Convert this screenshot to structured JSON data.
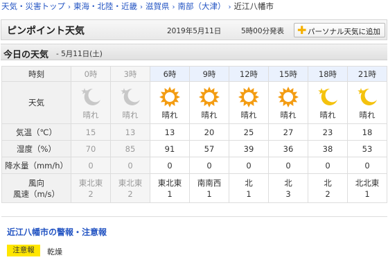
{
  "breadcrumb": [
    {
      "label": "天気・災害トップ",
      "link": true
    },
    {
      "label": "東海・北陸・近畿",
      "link": true
    },
    {
      "label": "滋賀県",
      "link": true
    },
    {
      "label": "南部（大津）",
      "link": true
    },
    {
      "label": "近江八幡市",
      "link": false
    }
  ],
  "breadcrumb_sep": "›",
  "pinpoint": {
    "title": "ピンポイント天気",
    "date": "2019年5月11日",
    "issued": "5時00分発表",
    "personal_button": "パーソナル天気に追加"
  },
  "today": {
    "title": "今日の天気",
    "date": "- 5月11日(土)"
  },
  "labels": {
    "time": "時刻",
    "weather": "天気",
    "temp": "気温（℃）",
    "humidity": "湿度（%）",
    "rain": "降水量（mm/h）",
    "wind_dir": "風向",
    "wind_speed": "風速（m/s）"
  },
  "hours": [
    {
      "time": "0時",
      "past": true,
      "icon": "moon-icon",
      "weather": "晴れ",
      "temp": "15",
      "humidity": "70",
      "rain": "0",
      "wind_dir": "東北東",
      "wind_speed": "2"
    },
    {
      "time": "3時",
      "past": true,
      "icon": "moon-icon",
      "weather": "晴れ",
      "temp": "13",
      "humidity": "85",
      "rain": "0",
      "wind_dir": "東北東",
      "wind_speed": "2"
    },
    {
      "time": "6時",
      "past": false,
      "icon": "sun-icon",
      "weather": "晴れ",
      "temp": "13",
      "humidity": "91",
      "rain": "0",
      "wind_dir": "東北東",
      "wind_speed": "1"
    },
    {
      "time": "9時",
      "past": false,
      "icon": "sun-icon",
      "weather": "晴れ",
      "temp": "20",
      "humidity": "57",
      "rain": "0",
      "wind_dir": "南南西",
      "wind_speed": "1"
    },
    {
      "time": "12時",
      "past": false,
      "icon": "sun-icon",
      "weather": "晴れ",
      "temp": "25",
      "humidity": "39",
      "rain": "0",
      "wind_dir": "北",
      "wind_speed": "1"
    },
    {
      "time": "15時",
      "past": false,
      "icon": "sun-icon",
      "weather": "晴れ",
      "temp": "27",
      "humidity": "36",
      "rain": "0",
      "wind_dir": "北",
      "wind_speed": "3"
    },
    {
      "time": "18時",
      "past": false,
      "icon": "moon-icon",
      "weather": "晴れ",
      "temp": "23",
      "humidity": "38",
      "rain": "0",
      "wind_dir": "北",
      "wind_speed": "2"
    },
    {
      "time": "21時",
      "past": false,
      "icon": "moon-icon",
      "weather": "晴れ",
      "temp": "18",
      "humidity": "53",
      "rain": "0",
      "wind_dir": "北北東",
      "wind_speed": "1"
    }
  ],
  "warnings": {
    "title": "近江八幡市の警報・注意報",
    "badge": "注意報",
    "item": "乾燥"
  },
  "colors": {
    "link": "#2455c3",
    "sun": "#f39c12",
    "moon_future": "#f4c20d",
    "moon_past": "#c8c8c8",
    "future_header": "#eaf1fd",
    "badge": "#ffe600",
    "plus": "#f5b000"
  }
}
